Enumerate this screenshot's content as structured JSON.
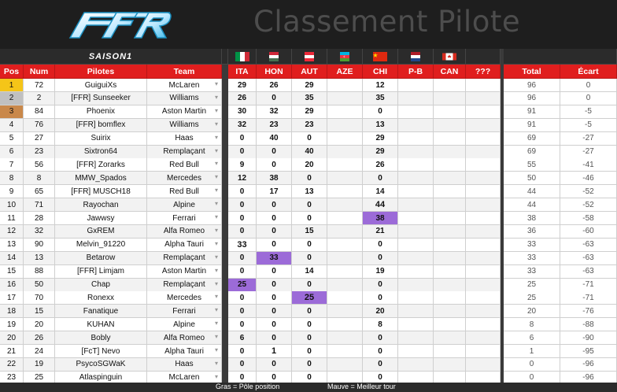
{
  "header": {
    "logo_text": "FFR",
    "title": "Classement Pilote"
  },
  "season": "SAISON1",
  "flags": [
    "italy-flag",
    "hungary-flag",
    "austria-flag",
    "azerbaijan-flag",
    "china-flag",
    "netherlands-flag",
    "canada-flag"
  ],
  "columns": {
    "pos": "Pos",
    "num": "Num",
    "pilotes": "Pilotes",
    "team": "Team",
    "races": [
      "ITA",
      "HON",
      "AUT",
      "AZE",
      "CHI",
      "P-B",
      "CAN",
      "???"
    ],
    "total": "Total",
    "ecart": "Écart"
  },
  "rows": [
    {
      "pos": "1",
      "num": "72",
      "pilote": "GuiguiXs",
      "team": "McLaren",
      "r": [
        "29",
        "26",
        "29",
        "",
        "12",
        "",
        "",
        ""
      ],
      "total": "96",
      "ecart": "0"
    },
    {
      "pos": "2",
      "num": "2",
      "pilote": "[FFR] Sunseeker",
      "team": "Williams",
      "r": [
        "26",
        "0",
        "35",
        "",
        "35",
        "",
        "",
        ""
      ],
      "total": "96",
      "ecart": "0"
    },
    {
      "pos": "3",
      "num": "84",
      "pilote": "Phoenix",
      "team": "Aston Martin",
      "r": [
        "30",
        "32",
        "29",
        "",
        "0",
        "",
        "",
        ""
      ],
      "total": "91",
      "ecart": "-5"
    },
    {
      "pos": "4",
      "num": "76",
      "pilote": "[FFR] bomflex",
      "team": "Williams",
      "r": [
        "32",
        "23",
        "23",
        "",
        "13",
        "",
        "",
        ""
      ],
      "total": "91",
      "ecart": "-5"
    },
    {
      "pos": "5",
      "num": "27",
      "pilote": "Suirix",
      "team": "Haas",
      "r": [
        "0",
        "40",
        "0",
        "",
        "29",
        "",
        "",
        ""
      ],
      "total": "69",
      "ecart": "-27"
    },
    {
      "pos": "6",
      "num": "23",
      "pilote": "Sixtron64",
      "team": "Remplaçant",
      "r": [
        "0",
        "0",
        "40",
        "",
        "29",
        "",
        "",
        ""
      ],
      "total": "69",
      "ecart": "-27"
    },
    {
      "pos": "7",
      "num": "56",
      "pilote": "[FFR] Zorarks",
      "team": "Red Bull",
      "r": [
        "9",
        "0",
        "20",
        "",
        "26",
        "",
        "",
        ""
      ],
      "total": "55",
      "ecart": "-41"
    },
    {
      "pos": "8",
      "num": "8",
      "pilote": "MMW_Spados",
      "team": "Mercedes",
      "r": [
        "12",
        "38",
        "0",
        "",
        "0",
        "",
        "",
        ""
      ],
      "total": "50",
      "ecart": "-46"
    },
    {
      "pos": "9",
      "num": "65",
      "pilote": "[FFR] MUSCH18",
      "team": "Red Bull",
      "r": [
        "0",
        "17",
        "13",
        "",
        "14",
        "",
        "",
        ""
      ],
      "total": "44",
      "ecart": "-52"
    },
    {
      "pos": "10",
      "num": "71",
      "pilote": "Rayochan",
      "team": "Alpine",
      "r": [
        "0",
        "0",
        "0",
        "",
        "44",
        "",
        "",
        ""
      ],
      "total": "44",
      "ecart": "-52"
    },
    {
      "pos": "11",
      "num": "28",
      "pilote": "Jawwsy",
      "team": "Ferrari",
      "r": [
        "0",
        "0",
        "0",
        "",
        "38",
        "",
        "",
        ""
      ],
      "total": "38",
      "ecart": "-58"
    },
    {
      "pos": "12",
      "num": "32",
      "pilote": "GxREM",
      "team": "Alfa Romeo",
      "r": [
        "0",
        "0",
        "15",
        "",
        "21",
        "",
        "",
        ""
      ],
      "total": "36",
      "ecart": "-60"
    },
    {
      "pos": "13",
      "num": "90",
      "pilote": "Melvin_91220",
      "team": "Alpha Tauri",
      "r": [
        "33",
        "0",
        "0",
        "",
        "0",
        "",
        "",
        ""
      ],
      "total": "33",
      "ecart": "-63"
    },
    {
      "pos": "14",
      "num": "13",
      "pilote": "Betarow",
      "team": "Remplaçant",
      "r": [
        "0",
        "33",
        "0",
        "",
        "0",
        "",
        "",
        ""
      ],
      "total": "33",
      "ecart": "-63"
    },
    {
      "pos": "15",
      "num": "88",
      "pilote": "[FFR] Limjam",
      "team": "Aston Martin",
      "r": [
        "0",
        "0",
        "14",
        "",
        "19",
        "",
        "",
        ""
      ],
      "total": "33",
      "ecart": "-63"
    },
    {
      "pos": "16",
      "num": "50",
      "pilote": "Chap",
      "team": "Remplaçant",
      "r": [
        "25",
        "0",
        "0",
        "",
        "0",
        "",
        "",
        ""
      ],
      "total": "25",
      "ecart": "-71"
    },
    {
      "pos": "17",
      "num": "70",
      "pilote": "Ronexx",
      "team": "Mercedes",
      "r": [
        "0",
        "0",
        "25",
        "",
        "0",
        "",
        "",
        ""
      ],
      "total": "25",
      "ecart": "-71"
    },
    {
      "pos": "18",
      "num": "15",
      "pilote": "Fanatique",
      "team": "Ferrari",
      "r": [
        "0",
        "0",
        "0",
        "",
        "20",
        "",
        "",
        ""
      ],
      "total": "20",
      "ecart": "-76"
    },
    {
      "pos": "19",
      "num": "20",
      "pilote": "KUHAN",
      "team": "Alpine",
      "r": [
        "0",
        "0",
        "0",
        "",
        "8",
        "",
        "",
        ""
      ],
      "total": "8",
      "ecart": "-88"
    },
    {
      "pos": "20",
      "num": "26",
      "pilote": "Bobly",
      "team": "Alfa Romeo",
      "r": [
        "6",
        "0",
        "0",
        "",
        "0",
        "",
        "",
        ""
      ],
      "total": "6",
      "ecart": "-90"
    },
    {
      "pos": "21",
      "num": "24",
      "pilote": "[FcT] Nevo",
      "team": "Alpha Tauri",
      "r": [
        "0",
        "1",
        "0",
        "",
        "0",
        "",
        "",
        ""
      ],
      "total": "1",
      "ecart": "-95"
    },
    {
      "pos": "22",
      "num": "19",
      "pilote": "PsycoSGWaK",
      "team": "Haas",
      "r": [
        "0",
        "0",
        "0",
        "",
        "0",
        "",
        "",
        ""
      ],
      "total": "0",
      "ecart": "-96"
    },
    {
      "pos": "23",
      "num": "25",
      "pilote": "Atlaspinguin",
      "team": "McLaren",
      "r": [
        "0",
        "0",
        "0",
        "",
        "0",
        "",
        "",
        ""
      ],
      "total": "0",
      "ecart": "-96"
    }
  ],
  "fastest_lap": [
    {
      "row": "11",
      "race": "CHI"
    },
    {
      "row": "14",
      "race": "HON"
    },
    {
      "row": "16",
      "race": "ITA"
    },
    {
      "row": "17",
      "race": "AUT"
    }
  ],
  "pole_position": [
    {
      "row": "10",
      "race": "CHI"
    },
    {
      "row": "13",
      "race": "ITA"
    },
    {
      "row": "17",
      "race": "AUT"
    },
    {
      "row": "21",
      "race": "HON"
    }
  ],
  "footer": {
    "bold_legend": "Gras = Pôle position",
    "mauve_legend": "Mauve = Meilleur tour"
  },
  "colors": {
    "header_red": "#e01e1e",
    "gold": "#f5c518",
    "silver": "#c0c0c0",
    "bronze": "#c9884a",
    "mauve": "#9c6bd8"
  }
}
